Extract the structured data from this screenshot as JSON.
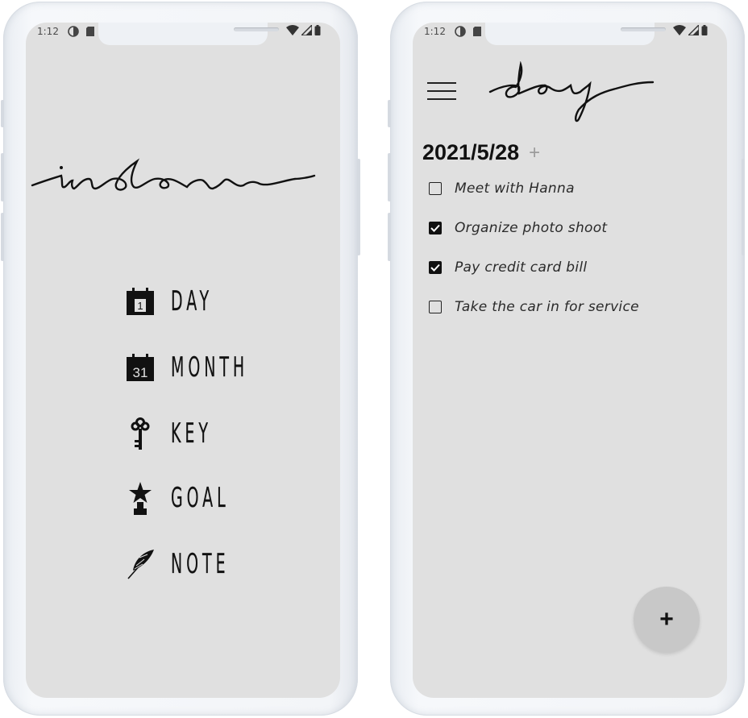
{
  "status_bar": {
    "time": "1:12"
  },
  "index_screen": {
    "title": "index",
    "items": [
      {
        "label": "DAY",
        "icon": "calendar-day-icon",
        "icon_text": "1"
      },
      {
        "label": "MONTH",
        "icon": "calendar-month-icon",
        "icon_text": "31"
      },
      {
        "label": "KEY",
        "icon": "key-icon"
      },
      {
        "label": "GOAL",
        "icon": "trophy-star-icon"
      },
      {
        "label": "NOTE",
        "icon": "feather-icon"
      }
    ]
  },
  "day_screen": {
    "title": "day",
    "date": "2021/5/28",
    "add_label": "+",
    "tasks": [
      {
        "text": "Meet with Hanna",
        "checked": false
      },
      {
        "text": "Organize photo shoot",
        "checked": true
      },
      {
        "text": "Pay credit card bill",
        "checked": true
      },
      {
        "text": "Take the car in for service",
        "checked": false
      }
    ],
    "fab_label": "+"
  },
  "colors": {
    "screen_bg": "#e0e0e0",
    "text": "#111111",
    "fab_bg": "#c8c8c8",
    "frame": "#f3f5f8"
  }
}
